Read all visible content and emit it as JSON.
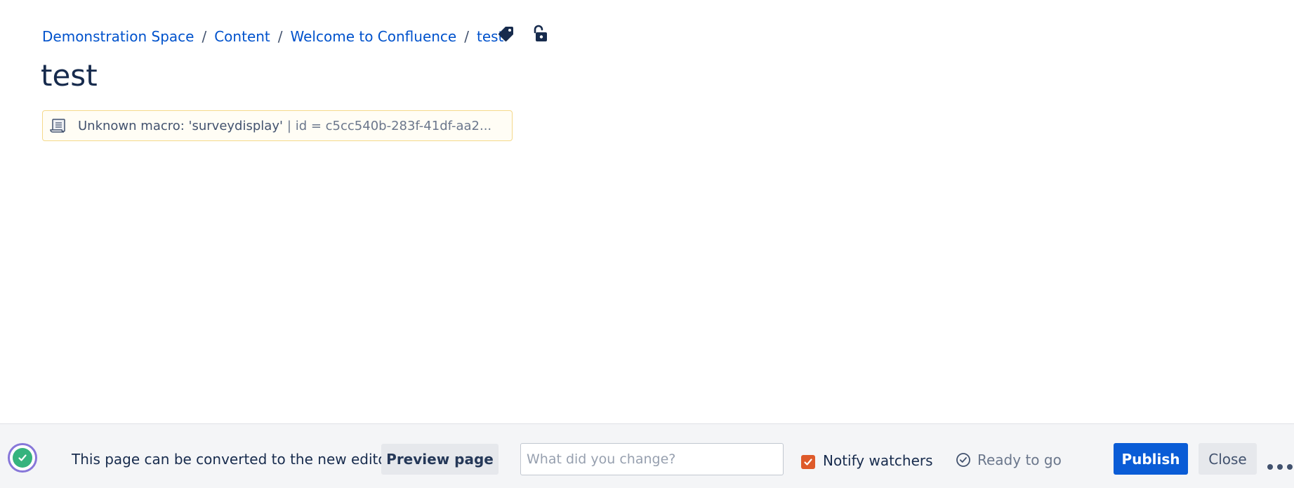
{
  "breadcrumb": {
    "items": [
      {
        "label": "Demonstration Space"
      },
      {
        "label": "Content"
      },
      {
        "label": "Welcome to Confluence"
      },
      {
        "label": "test"
      }
    ],
    "separator": "/"
  },
  "icons": {
    "labels": "tag-icon",
    "restrictions": "unlock-icon"
  },
  "page": {
    "title": "test"
  },
  "macro": {
    "name": "Unknown macro: 'surveydisplay'",
    "params": "| id = c5cc540b-283f-41df-aa2..."
  },
  "toolbar": {
    "convert_text": "This page can be converted to the new editor",
    "preview_label": "Preview page",
    "change_placeholder": "What did you change?",
    "change_value": "",
    "notify_checked": true,
    "notify_label": "Notify watchers",
    "ready_text": "Ready to go",
    "publish_label": "Publish",
    "close_label": "Close"
  },
  "colors": {
    "link": "#0052cc",
    "publish": "#0a5cd6",
    "checkbox": "#de5a2a",
    "status_ring": "#8777d9",
    "status_fill": "#36b37e"
  }
}
